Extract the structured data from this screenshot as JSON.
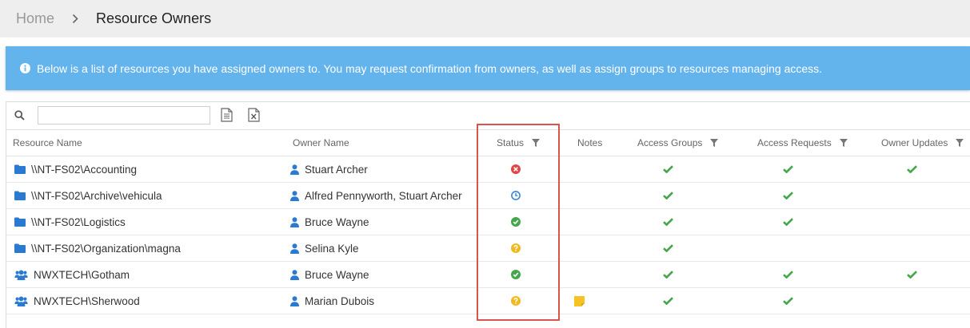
{
  "breadcrumb": {
    "home": "Home",
    "current": "Resource Owners"
  },
  "banner": {
    "text": "Below is a list of resources you have assigned owners to. You may request confirmation from owners, as well as assign groups to resources managing access."
  },
  "toolbar": {
    "search_value": "",
    "search_placeholder": ""
  },
  "columns": {
    "resource_name": "Resource Name",
    "owner_name": "Owner Name",
    "status": "Status",
    "notes": "Notes",
    "access_groups": "Access Groups",
    "access_requests": "Access Requests",
    "owner_updates": "Owner Updates"
  },
  "colors": {
    "folder": "#2a7ad2",
    "error": "#e04646",
    "pending": "#3a87d6",
    "ok": "#45a64c",
    "unknown": "#f0b91e",
    "note": "#f6c324",
    "check": "#45a64c"
  },
  "rows": [
    {
      "resource": "\\\\NT-FS02\\Accounting",
      "type": "folder",
      "owner": "Stuart Archer",
      "status": "error",
      "note": false,
      "access_groups": true,
      "access_requests": true,
      "owner_updates": true
    },
    {
      "resource": "\\\\NT-FS02\\Archive\\vehicula",
      "type": "folder",
      "owner": "Alfred Pennyworth, Stuart Archer",
      "status": "pending",
      "note": false,
      "access_groups": true,
      "access_requests": true,
      "owner_updates": false
    },
    {
      "resource": "\\\\NT-FS02\\Logistics",
      "type": "folder",
      "owner": "Bruce Wayne",
      "status": "ok",
      "note": false,
      "access_groups": true,
      "access_requests": true,
      "owner_updates": false
    },
    {
      "resource": "\\\\NT-FS02\\Organization\\magna",
      "type": "folder",
      "owner": "Selina Kyle",
      "status": "unknown",
      "note": false,
      "access_groups": true,
      "access_requests": false,
      "owner_updates": false
    },
    {
      "resource": "NWXTECH\\Gotham",
      "type": "group",
      "owner": "Bruce Wayne",
      "status": "ok",
      "note": false,
      "access_groups": true,
      "access_requests": true,
      "owner_updates": true
    },
    {
      "resource": "NWXTECH\\Sherwood",
      "type": "group",
      "owner": "Marian Dubois",
      "status": "unknown",
      "note": true,
      "access_groups": true,
      "access_requests": true,
      "owner_updates": false
    }
  ]
}
